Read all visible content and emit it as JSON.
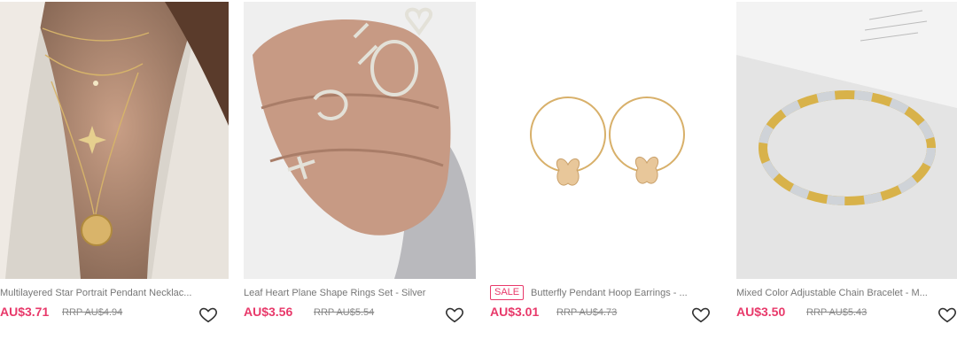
{
  "products": [
    {
      "title": "Multilayered Star Portrait Pendant Necklac...",
      "price": "AU$3.71",
      "rrp": "RRP AU$4.94",
      "badge": "",
      "wishlist_icon": "heart-outline-icon"
    },
    {
      "title": "Leaf Heart Plane Shape Rings Set - Silver",
      "price": "AU$3.56",
      "rrp": "RRP AU$5.54",
      "badge": "",
      "wishlist_icon": "heart-outline-icon"
    },
    {
      "title": "Butterfly Pendant Hoop Earrings - ...",
      "price": "AU$3.01",
      "rrp": "RRP AU$4.73",
      "badge": "SALE",
      "wishlist_icon": "heart-outline-icon"
    },
    {
      "title": "Mixed Color Adjustable Chain Bracelet - M...",
      "price": "AU$3.50",
      "rrp": "RRP AU$5.43",
      "badge": "",
      "wishlist_icon": "heart-outline-icon"
    }
  ],
  "colors": {
    "price": "#e8396a",
    "rrp": "#888888",
    "title": "#777777",
    "sale_badge": "#e8396a"
  }
}
